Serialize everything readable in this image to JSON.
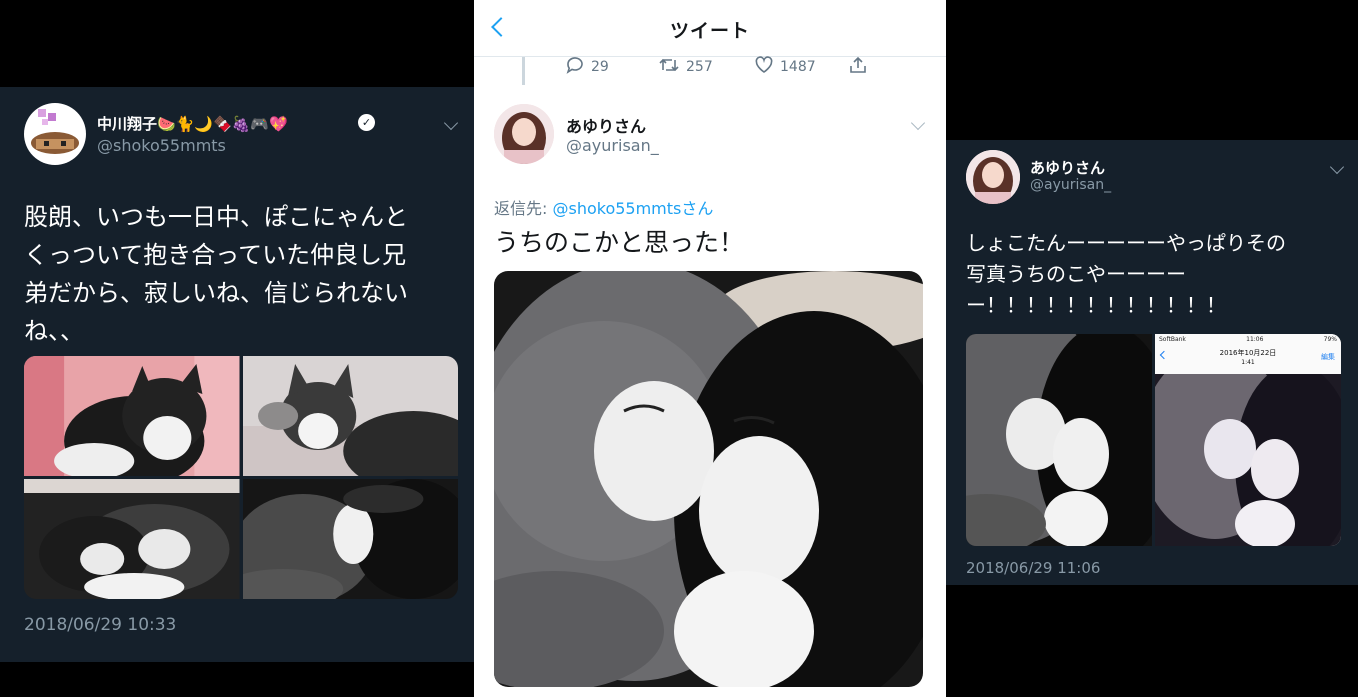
{
  "left_tweet": {
    "display_name": "中川翔子🍉🐈🌙🍫🍇🎮💖",
    "handle": "@shoko55mmts",
    "text_lines": [
      "股朗、いつも一日中、ぽこにゃんと",
      "くっついて抱き合っていた仲良し兄",
      "弟だから、寂しいね、信じられない",
      "ね、、"
    ],
    "timestamp": "2018/06/29 10:33"
  },
  "middle_screen": {
    "nav_title": "ツイート",
    "parent_actions": {
      "replies": "29",
      "retweets": "257",
      "likes": "1487"
    },
    "reply": {
      "display_name": "あゆりさん",
      "handle": "@ayurisan_",
      "reply_to_prefix": "返信先: ",
      "reply_to_handle": "@shoko55mmtsさん",
      "text": "うちのこかと思った！"
    }
  },
  "right_tweet": {
    "display_name": "あゆりさん",
    "handle": "@ayurisan_",
    "text_lines": [
      "しょこたんーーーーーやっぱりその",
      "写真うちのこやーーーー",
      "ー！！！！！！！！！！！！"
    ],
    "timestamp": "2018/06/29 11:06",
    "embedded_screenshot": {
      "carrier": "SoftBank",
      "time": "11:06",
      "battery": "79%",
      "date": "2016年10月22日",
      "subtime": "1:41",
      "edit": "編集"
    }
  },
  "colors": {
    "dark_bg": "#15202b",
    "dark_secondary": "#8899a6",
    "twitter_blue": "#1da1f2",
    "verified": "#ffffff"
  }
}
